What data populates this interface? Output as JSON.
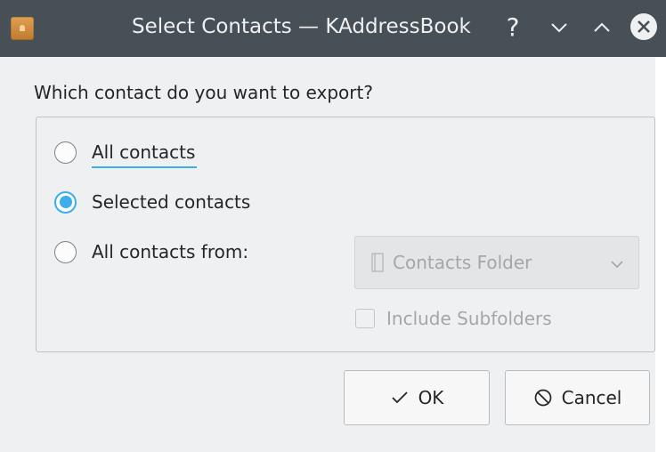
{
  "window": {
    "title": "Select Contacts — KAddressBook",
    "help_glyph": "?",
    "icons": {
      "app": "kaddressbook-app-icon",
      "help": "help-icon",
      "minimize": "chevron-down-icon",
      "maximize": "chevron-up-icon",
      "close": "close-icon"
    }
  },
  "dialog": {
    "question": "Which contact do you want to export?",
    "options": [
      {
        "label": "All contacts",
        "checked": false,
        "focused": true
      },
      {
        "label": "Selected contacts",
        "checked": true,
        "focused": false
      },
      {
        "label": "All contacts from:",
        "checked": false,
        "focused": false
      }
    ],
    "folder_combo": {
      "value": "Contacts Folder",
      "enabled": false,
      "icon": "folder-icon"
    },
    "include_subfolders": {
      "label": "Include Subfolders",
      "checked": false,
      "enabled": false
    },
    "buttons": {
      "ok_label": "OK",
      "cancel_label": "Cancel",
      "ok_icon": "checkmark-icon",
      "cancel_icon": "cancel-icon"
    }
  },
  "colors": {
    "accent": "#3daee9",
    "titlebar": "#475057",
    "dialog_bg": "#eff0f1",
    "text": "#232627",
    "disabled_text": "#a4a7a9"
  }
}
